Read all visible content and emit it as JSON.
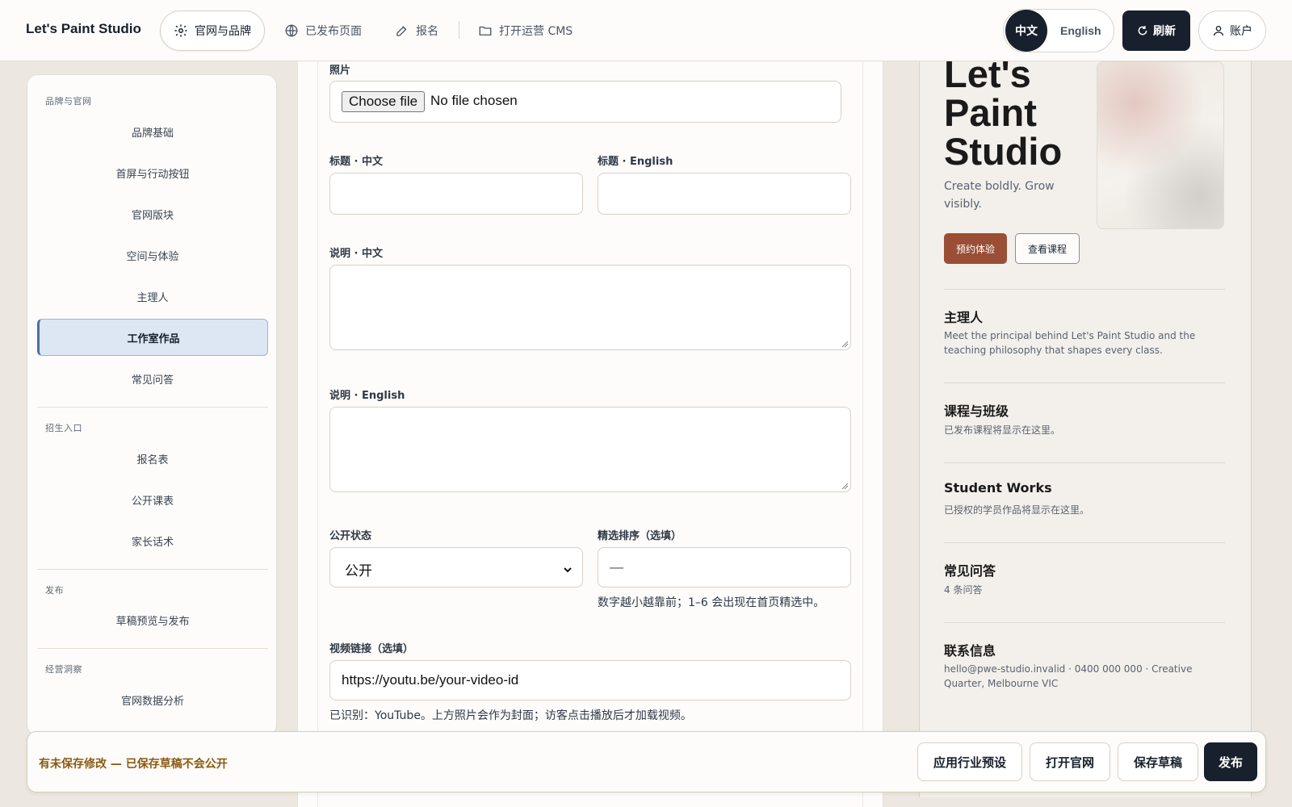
{
  "header": {
    "brand": "Let's Paint Studio",
    "nav": {
      "site_brand": "官网与品牌",
      "published": "已发布页面",
      "signup": "报名",
      "open_cms": "打开运营 CMS"
    },
    "lang_zh": "中文",
    "lang_en": "English",
    "refresh": "刷新",
    "account": "账户"
  },
  "sidebar": {
    "group1": "品牌与官网",
    "items1": [
      "品牌基础",
      "首屏与行动按钮",
      "官网版块",
      "空间与体验",
      "主理人",
      "工作室作品",
      "常见问答"
    ],
    "group2": "招生入口",
    "items2": [
      "报名表",
      "公开课表",
      "家长话术"
    ],
    "group3": "发布",
    "items3": [
      "草稿预览与发布"
    ],
    "group4": "经营洞察",
    "items4": [
      "官网数据分析"
    ]
  },
  "form": {
    "photo_label": "照片",
    "file_button": "Choose file",
    "file_status": "No file chosen",
    "title_zh_label": "标题 · 中文",
    "title_en_label": "标题 · English",
    "desc_zh_label": "说明 · 中文",
    "desc_en_label": "说明 · English",
    "visibility_label": "公开状态",
    "visibility_value": "公开",
    "sort_label": "精选排序（选填）",
    "sort_placeholder": "—",
    "sort_help": "数字越小越靠前；1–6 会出现在首页精选中。",
    "video_label": "视频链接（选填）",
    "video_value": "https://youtu.be/your-video-id",
    "video_help": "已识别：YouTube。上方照片会作为封面；访客点击播放后才加载视频。"
  },
  "preview": {
    "hero_title": "Let's Paint Studio",
    "hero_sub": "Create boldly. Grow visibly.",
    "btn_book": "预约体验",
    "btn_courses": "查看课程",
    "sections": [
      {
        "heading": "主理人",
        "text": "Meet the principal behind Let's Paint Studio and the teaching philosophy that shapes every class."
      },
      {
        "heading": "课程与班级",
        "text": "已发布课程将显示在这里。"
      },
      {
        "heading": "Student Works",
        "text": "已授权的学员作品将显示在这里。"
      },
      {
        "heading": "常见问答",
        "text": "4 条问答"
      },
      {
        "heading": "联系信息",
        "text": "hello@pwe-studio.invalid · 0400 000 000 · Creative Quarter, Melbourne VIC"
      }
    ]
  },
  "footer": {
    "unsaved": "有未保存修改 — 已保存草稿不会公开",
    "apply_preset": "应用行业预设",
    "open_site": "打开官网",
    "save_draft": "保存草稿",
    "publish": "发布"
  },
  "colors": {
    "primary_dark": "#17202c",
    "accent_terracotta": "#9a4e35",
    "active_sidebar": "#dde6f3",
    "warning_text": "#8a5a12"
  },
  "icons": [
    "gear-icon",
    "globe-icon",
    "edit-icon",
    "folder-icon",
    "refresh-icon",
    "user-icon"
  ]
}
